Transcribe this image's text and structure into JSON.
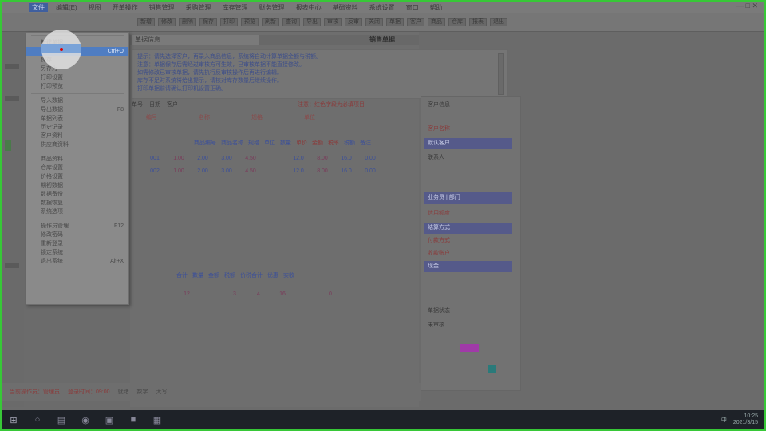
{
  "menubar": {
    "items": [
      "文件",
      "编辑(E)",
      "视图",
      "开单操作",
      "销售管理",
      "采购管理",
      "库存管理",
      "财务管理",
      "报表中心",
      "基础资料",
      "系统设置",
      "窗口",
      "帮助"
    ],
    "active_index": 0,
    "window_controls": "— □ ✕"
  },
  "toolbar": {
    "buttons": [
      "新增",
      "修改",
      "删除",
      "保存",
      "打印",
      "预览",
      "刷新",
      "查询",
      "导出",
      "审核",
      "反审",
      "关闭",
      "单据",
      "客户",
      "商品",
      "仓库",
      "报表",
      "退出"
    ]
  },
  "dropdown": {
    "items": [
      {
        "label": "新建单据",
        "shortcut": ""
      },
      {
        "label": "打开单据",
        "shortcut": "Ctrl+O"
      },
      {
        "label": "保存",
        "shortcut": ""
      },
      {
        "label": "另存为",
        "shortcut": ""
      },
      {
        "label": "打印设置",
        "shortcut": ""
      },
      {
        "label": "打印预览",
        "shortcut": ""
      },
      {
        "label": "导入数据",
        "shortcut": ""
      },
      {
        "label": "导出数据",
        "shortcut": "F8"
      },
      {
        "label": "单据列表",
        "shortcut": ""
      },
      {
        "label": "历史记录",
        "shortcut": ""
      },
      {
        "label": "客户资料",
        "shortcut": ""
      },
      {
        "label": "供应商资料",
        "shortcut": ""
      },
      {
        "label": "商品资料",
        "shortcut": ""
      },
      {
        "label": "仓库设置",
        "shortcut": ""
      },
      {
        "label": "价格设置",
        "shortcut": ""
      },
      {
        "label": "期初数据",
        "shortcut": ""
      },
      {
        "label": "数据备份",
        "shortcut": ""
      },
      {
        "label": "数据恢复",
        "shortcut": ""
      },
      {
        "label": "系统选项",
        "shortcut": ""
      },
      {
        "label": "操作员管理",
        "shortcut": "F12"
      },
      {
        "label": "修改密码",
        "shortcut": ""
      },
      {
        "label": "重新登录",
        "shortcut": ""
      },
      {
        "label": "锁定系统",
        "shortcut": ""
      },
      {
        "label": "退出系统",
        "shortcut": "Alt+X"
      }
    ],
    "selected_index": 1
  },
  "main": {
    "panel_title": "单据信息",
    "form_title": "销售单据",
    "notice_lines": [
      "提示：请先选择客户，再录入商品信息，系统将自动计算单据金额与税额。",
      "注意：单据保存后需经过审核方可生效，已审核单据不能直接修改。",
      "如需修改已审核单据，请先执行反审核操作后再进行编辑。",
      "库存不足时系统将给出提示，请核对库存数量后继续操作。",
      "打印单据前请确认打印机设置正确。"
    ],
    "sub_labels": [
      "单号",
      "日期",
      "客户"
    ],
    "red_notice": "注意：红色字段为必填项目",
    "sub_row2": [
      "编号",
      "名称",
      "规格",
      "单位"
    ],
    "table_header": [
      "商品编号",
      "商品名称",
      "规格",
      "单位",
      "数量",
      "单价",
      "金额",
      "税率",
      "税额",
      "备注"
    ],
    "grid_rows": [
      [
        "001",
        "1.00",
        "2.00",
        "3.00",
        "4.50",
        "",
        "12.0",
        "8.00",
        "16.0",
        "0.00",
        "",
        "",
        "",
        ""
      ],
      [
        "002",
        "1.00",
        "2.00",
        "3.00",
        "4.50",
        "",
        "12.0",
        "8.00",
        "16.0",
        "0.00",
        "",
        "",
        "",
        ""
      ]
    ],
    "grid2_header": [
      "合计",
      "数量",
      "金额",
      "税额",
      "价税合计",
      "优惠",
      "实收"
    ],
    "grid2_values": [
      "12",
      "",
      "3",
      "4",
      "16",
      "",
      "0"
    ]
  },
  "right_panel": {
    "rows": [
      {
        "kind": "plain",
        "text": "客户信息"
      },
      {
        "kind": "label",
        "text": "客户名称"
      },
      {
        "kind": "val",
        "text": "默认客户"
      },
      {
        "kind": "plain",
        "text": "联系人"
      },
      {
        "kind": "val",
        "text": "业务员 | 部门"
      },
      {
        "kind": "label",
        "text": "信用额度"
      },
      {
        "kind": "val",
        "text": "结算方式"
      },
      {
        "kind": "label",
        "text": "付款方式"
      },
      {
        "kind": "label",
        "text": "收款账户"
      },
      {
        "kind": "val",
        "text": "现金"
      },
      {
        "kind": "plain",
        "text": "单据状态"
      },
      {
        "kind": "plain",
        "text": "未审核"
      }
    ]
  },
  "status": {
    "red_items": [
      "当前操作员：管理员",
      "登录时间：09:00"
    ],
    "grey_items": [
      "就绪",
      "数字",
      "大写"
    ]
  },
  "taskbar": {
    "icons": [
      "start-icon",
      "search-icon",
      "folder-icon",
      "browser-icon",
      "app-icon",
      "app2-icon",
      "app3-icon"
    ],
    "tray_text": "中",
    "time": "10:25",
    "date": "2021/3/15"
  }
}
